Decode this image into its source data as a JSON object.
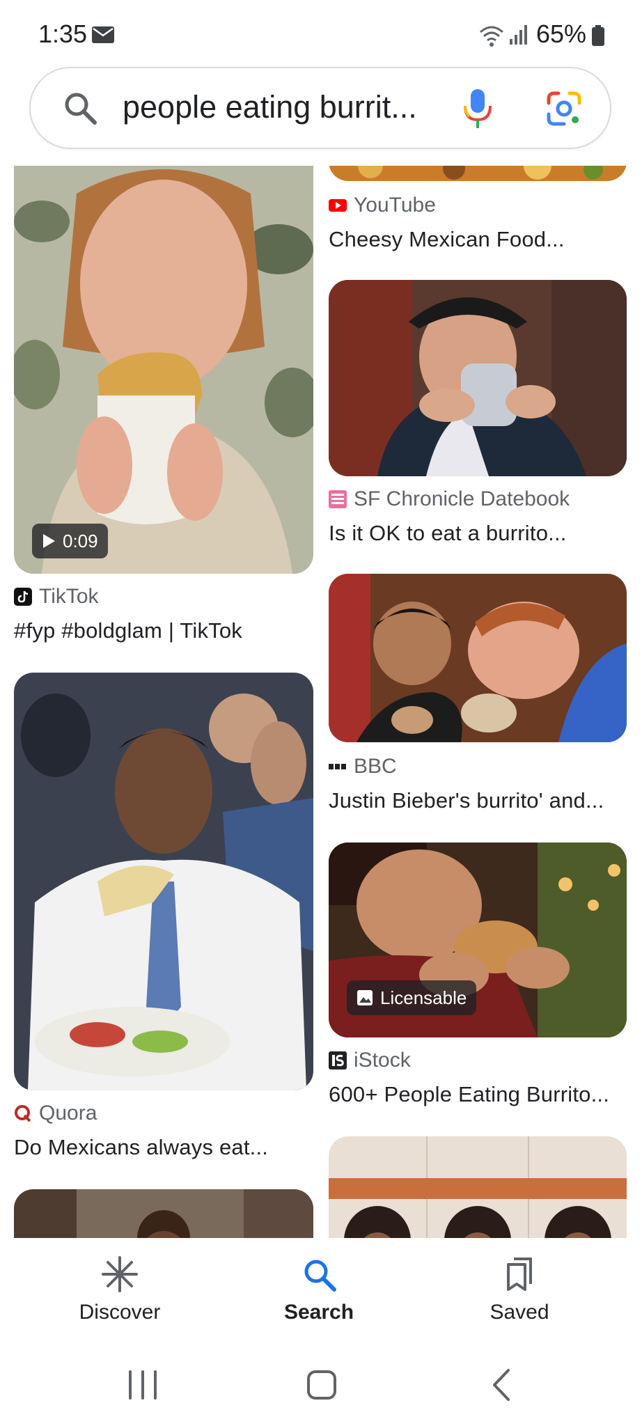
{
  "status_bar": {
    "time": "1:35",
    "battery": "65%"
  },
  "search": {
    "query": "people eating burrit..."
  },
  "results": {
    "left": [
      {
        "source": "TikTok",
        "title": "#fyp #boldglam | TikTok",
        "badge": "0:09"
      },
      {
        "source": "Quora",
        "title": "Do Mexicans always eat..."
      }
    ],
    "right": [
      {
        "source": "YouTube",
        "title": "Cheesy Mexican Food..."
      },
      {
        "source": "SF Chronicle Datebook",
        "title": "Is it OK to eat a burrito..."
      },
      {
        "source": "BBC",
        "title": "Justin Bieber's burrito' and..."
      },
      {
        "source": "iStock",
        "title": "600+ People Eating Burrito...",
        "badge": "Licensable"
      }
    ]
  },
  "bottom_nav": {
    "items": [
      {
        "label": "Discover",
        "icon": "asterisk-icon"
      },
      {
        "label": "Search",
        "icon": "search-icon",
        "active": true
      },
      {
        "label": "Saved",
        "icon": "bookmarks-icon"
      }
    ]
  },
  "colors": {
    "accent": "#1a73e8",
    "youtube": "#ff0000",
    "quora": "#b92b27"
  }
}
